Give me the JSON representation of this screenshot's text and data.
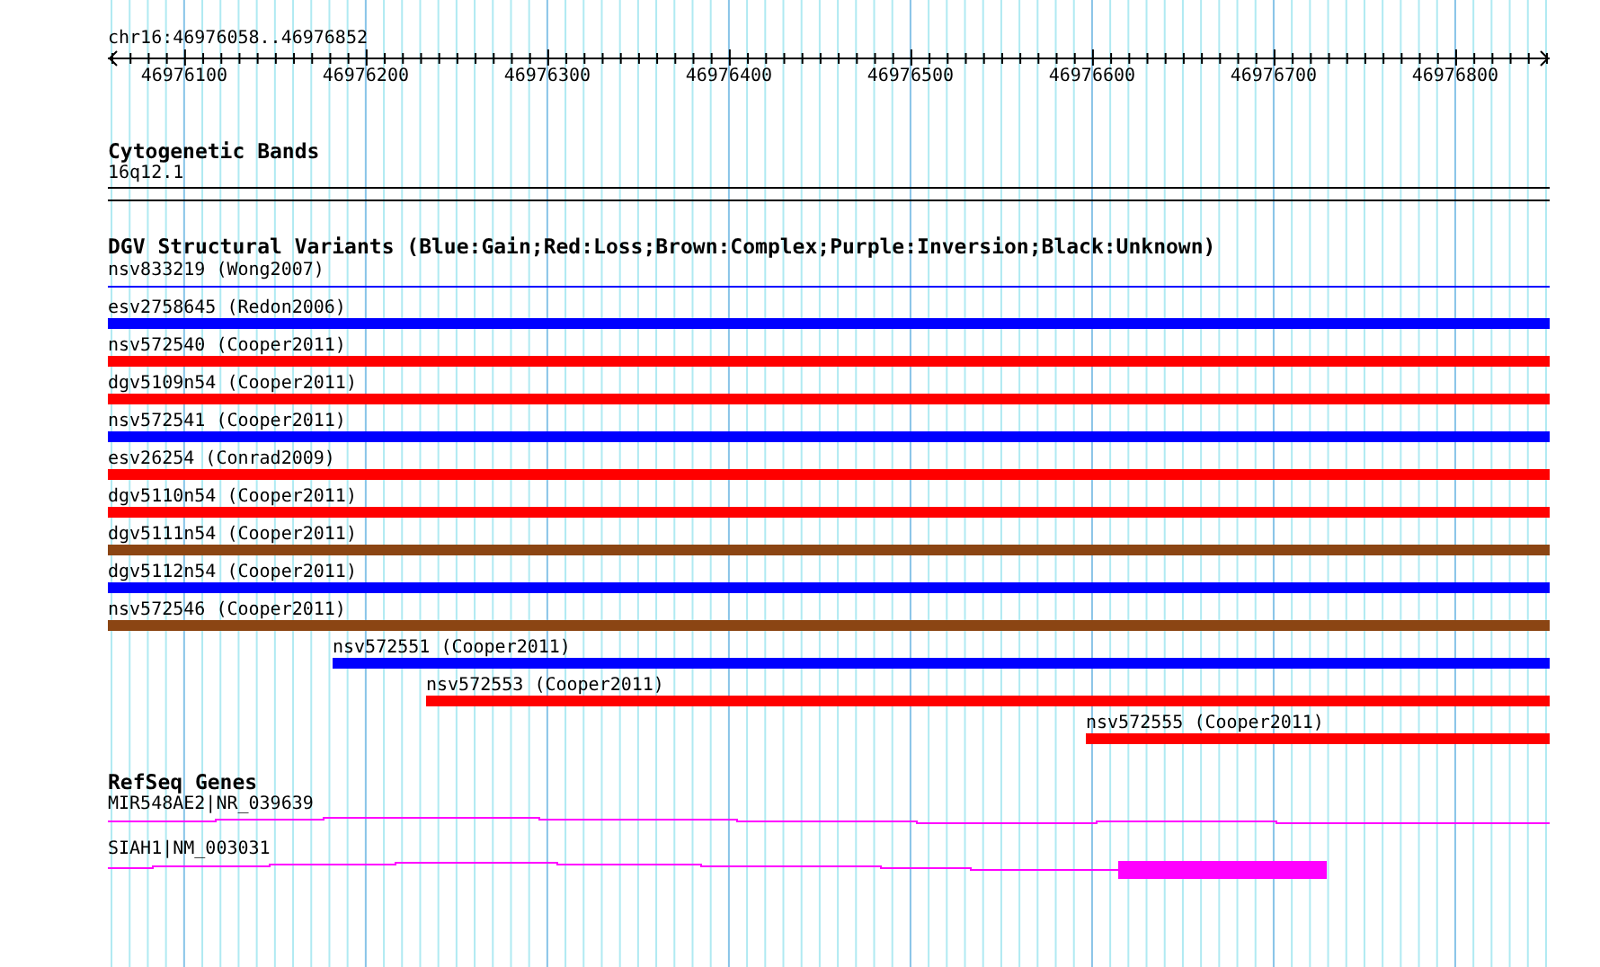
{
  "ruler": {
    "range": "chr16:46976058..46976852",
    "ticks": [
      "46976100",
      "46976200",
      "46976300",
      "46976400",
      "46976500",
      "46976600",
      "46976700",
      "46976800"
    ]
  },
  "tracks": [
    {
      "kind": "bands",
      "title": "Cytogenetic Bands",
      "features": [
        {
          "label": "16q12.1",
          "kind": "band"
        }
      ]
    },
    {
      "kind": "variants",
      "title": "DGV Structural Variants (Blue:Gain;Red:Loss;Brown:Complex;Purple:Inversion;Black:Unknown)",
      "features": [
        {
          "label": "nsv833219 (Wong2007)",
          "kind": "thin",
          "color": "#0000ff"
        },
        {
          "label": "esv2758645 (Redon2006)",
          "kind": "bar",
          "color": "#0000ff"
        },
        {
          "label": "nsv572540 (Cooper2011)",
          "kind": "bar",
          "color": "#ff0000"
        },
        {
          "label": "dgv5109n54 (Cooper2011)",
          "kind": "bar",
          "color": "#ff0000"
        },
        {
          "label": "nsv572541 (Cooper2011)",
          "kind": "bar",
          "color": "#0000ff"
        },
        {
          "label": "esv26254 (Conrad2009)",
          "kind": "bar",
          "color": "#ff0000"
        },
        {
          "label": "dgv5110n54 (Cooper2011)",
          "kind": "bar",
          "color": "#ff0000"
        },
        {
          "label": "dgv5111n54 (Cooper2011)",
          "kind": "bar",
          "color": "#8b4513"
        },
        {
          "label": "dgv5112n54 (Cooper2011)",
          "kind": "bar",
          "color": "#0000ff"
        },
        {
          "label": "nsv572546 (Cooper2011)",
          "kind": "bar",
          "color": "#8b4513"
        },
        {
          "label": "nsv572551 (Cooper2011)",
          "kind": "bar",
          "color": "#0000ff"
        },
        {
          "label": "nsv572553 (Cooper2011)",
          "kind": "bar",
          "color": "#ff0000"
        },
        {
          "label": "nsv572555 (Cooper2011)",
          "kind": "bar",
          "color": "#ff0000"
        }
      ]
    },
    {
      "kind": "genes",
      "title": "RefSeq Genes",
      "features": [
        {
          "label": "MIR548AE2|NR_039639",
          "kind": "noncoding"
        },
        {
          "label": "SIAH1|NM_003031",
          "kind": "coding"
        }
      ]
    }
  ]
}
